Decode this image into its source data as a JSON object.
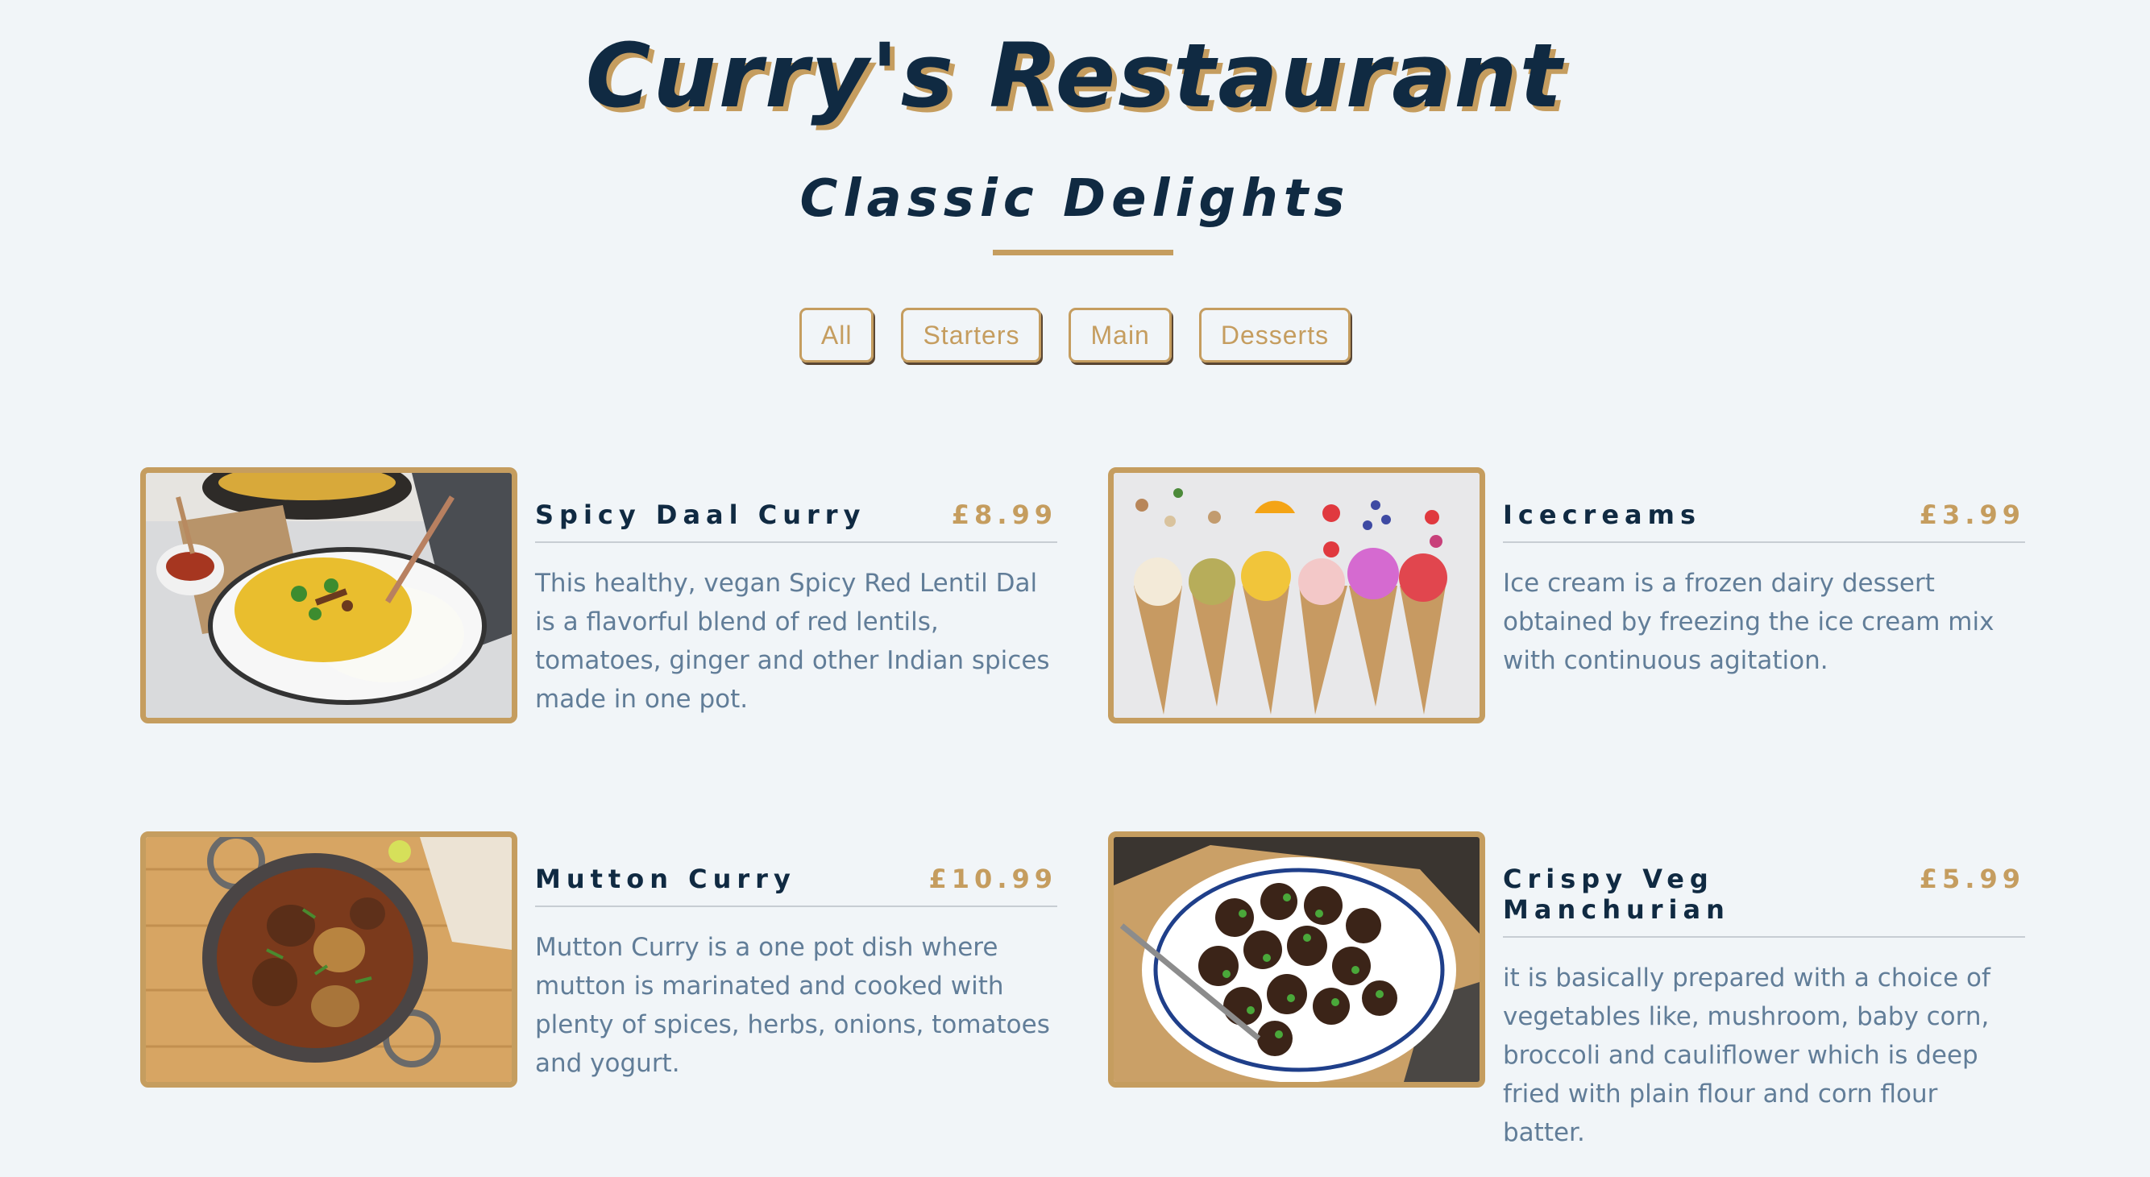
{
  "header": {
    "title": "Curry's Restaurant",
    "subtitle": "Classic Delights"
  },
  "filters": [
    "All",
    "Starters",
    "Main",
    "Desserts"
  ],
  "menu": [
    {
      "name": "Spicy Daal Curry",
      "price": "£8.99",
      "description": "This healthy, vegan Spicy Red Lentil Dal is a flavorful blend of red lentils, tomatoes, ginger and other Indian spices made in one pot.",
      "photo": "dal-curry-photo"
    },
    {
      "name": "Icecreams",
      "price": "£3.99",
      "description": "Ice cream is a frozen dairy dessert obtained by freezing the ice cream mix with continuous agitation.",
      "photo": "ice-cream-cones-photo"
    },
    {
      "name": "Mutton Curry",
      "price": "£10.99",
      "description": "Mutton Curry is a one pot dish where mutton is marinated and cooked with plenty of spices, herbs, onions, tomatoes and yogurt.",
      "photo": "mutton-curry-photo"
    },
    {
      "name": "Crispy Veg Manchurian",
      "price": "£5.99",
      "description": "it is basically prepared with a choice of vegetables like, mushroom, baby corn, broccoli and cauliflower which is deep fried with plain flour and corn flour batter.",
      "photo": "veg-manchurian-photo"
    }
  ],
  "colors": {
    "background": "#f1f5f8",
    "primary": "#102a42",
    "accent": "#c59d5f",
    "text_muted": "#617d98"
  }
}
